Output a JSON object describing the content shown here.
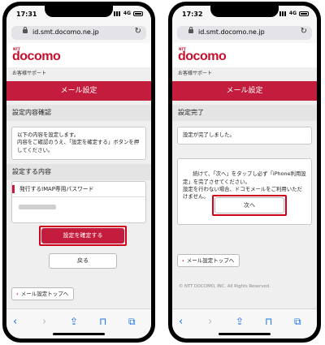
{
  "left": {
    "status": {
      "time": "17:31",
      "network": "4G"
    },
    "url": "id.smt.docomo.ne.jp",
    "brand": {
      "ntt": "NTT",
      "logo": "docomo"
    },
    "breadcrumb": "お客様サポート",
    "title": "メール設定",
    "confirm_heading": "設定内容確認",
    "confirm_message": "以下の内容を設定します。\n内容をご確認のうえ、「設定を確定する」ボタンを押してください。",
    "settings_heading": "設定する内容",
    "password_label": "発行するIMAP専用パスワード",
    "confirm_button": "設定を確定する",
    "back_button": "戻る",
    "top_link": "メール設定トップへ"
  },
  "right": {
    "status": {
      "time": "17:32",
      "network": "4G"
    },
    "url": "id.smt.docomo.ne.jp",
    "brand": {
      "ntt": "NTT",
      "logo": "docomo"
    },
    "breadcrumb": "お客様サポート",
    "title": "メール設定",
    "done_heading": "設定完了",
    "done_message": "設定が完了しました。",
    "next_message": "続けて、「次へ」をタップし必ず「iPhone利用設定」を完了させてください。\n設定を行わない場合、ドコモメールをご利用いただけません。",
    "next_button": "次へ",
    "top_link": "メール設定トップへ",
    "copyright": "© NTT DOCOMO, INC. All Rights Reserved."
  },
  "colors": {
    "brand_red": "#c41c3c",
    "highlight": "#d0021b",
    "ios_blue": "#1a73e8"
  },
  "toolbar_icons": [
    "back-icon",
    "forward-icon",
    "share-icon",
    "bookmarks-icon",
    "tabs-icon"
  ]
}
